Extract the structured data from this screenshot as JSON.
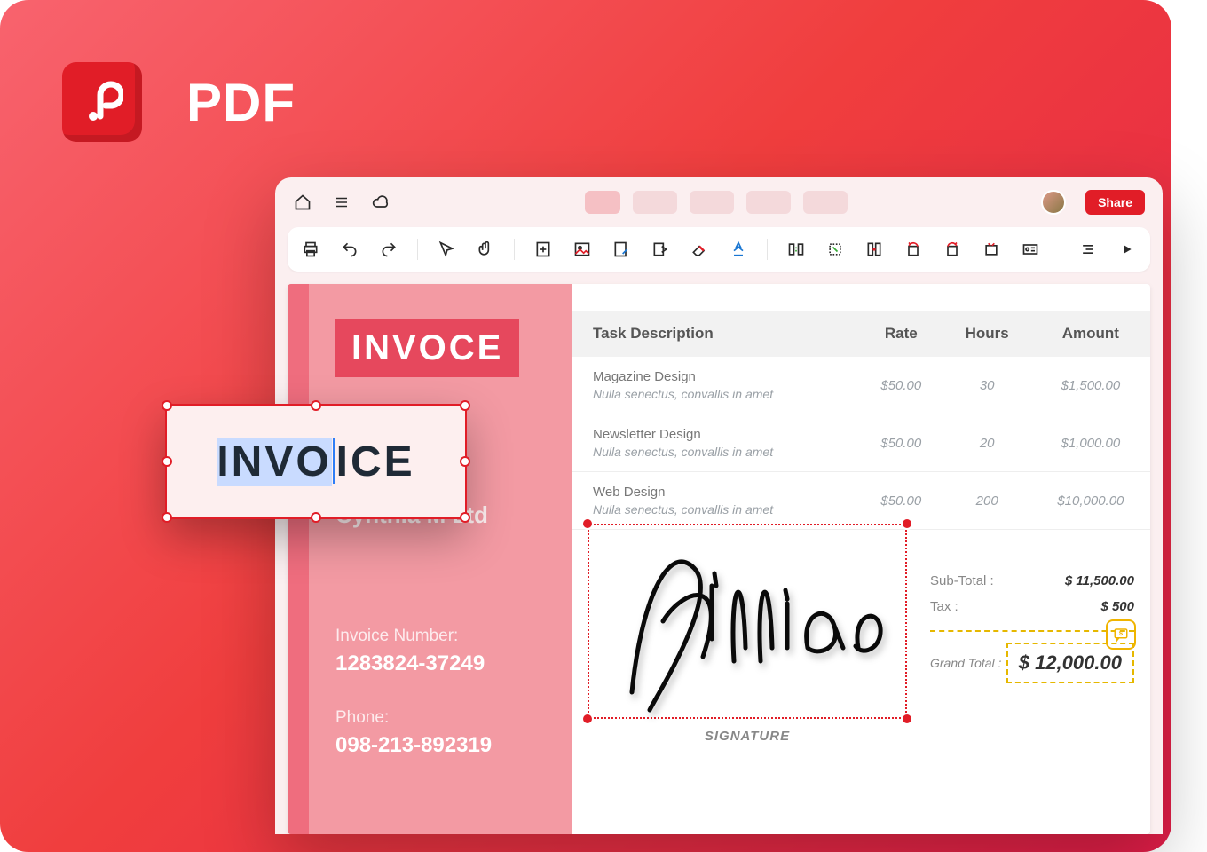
{
  "brand": {
    "title": "PDF"
  },
  "titlebar": {
    "share_label": "Share"
  },
  "invoice": {
    "badge_misspelled": "INVOCE",
    "edit_prefix": "INVO",
    "edit_suffix": "ICE",
    "company": "Cynthia M Ltd",
    "number_label": "Invoice Number:",
    "number_value": "1283824-37249",
    "phone_label": "Phone:",
    "phone_value": "098-213-892319"
  },
  "table": {
    "headers": {
      "task": "Task Description",
      "rate": "Rate",
      "hours": "Hours",
      "amount": "Amount"
    },
    "rows": [
      {
        "title": "Magazine Design",
        "sub": "Nulla senectus, convallis in amet",
        "rate": "$50.00",
        "hours": "30",
        "amount": "$1,500.00"
      },
      {
        "title": "Newsletter Design",
        "sub": "Nulla senectus, convallis in amet",
        "rate": "$50.00",
        "hours": "20",
        "amount": "$1,000.00"
      },
      {
        "title": "Web Design",
        "sub": "Nulla senectus, convallis in amet",
        "rate": "$50.00",
        "hours": "200",
        "amount": "$10,000.00"
      }
    ]
  },
  "totals": {
    "subtotal_label": "Sub-Total :",
    "subtotal_value": "$ 11,500.00",
    "tax_label": "Tax :",
    "tax_value": "$ 500",
    "grand_label": "Grand Total :",
    "grand_value": "$ 12,000.00"
  },
  "signature": {
    "label": "SIGNATURE",
    "name": "Jillian"
  }
}
